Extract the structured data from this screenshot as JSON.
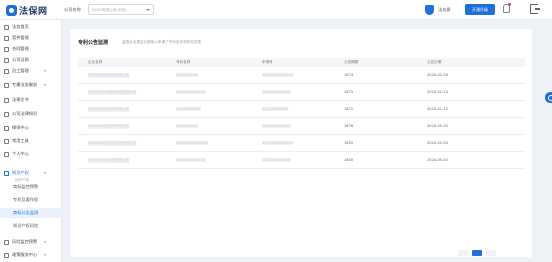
{
  "header": {
    "logo_text": "法保网",
    "company_label": "公司名称",
    "company_select_value": "XXXX有限公司(示例)",
    "shield_label": "法务盾",
    "upgrade_button": "开通升级"
  },
  "sidebar": {
    "items": [
      {
        "label": "法务首页"
      },
      {
        "label": "案件管理"
      },
      {
        "label": "合同管理"
      },
      {
        "label": "公司证照"
      },
      {
        "label": "员工管理"
      },
      {
        "label": "专属法务服务"
      },
      {
        "label": "法律文书"
      },
      {
        "label": "公司法律知识"
      },
      {
        "label": "律师中心"
      },
      {
        "label": "常用工具"
      },
      {
        "label": "个人中心"
      }
    ],
    "divider": "知识产权",
    "ip_group": {
      "label": "知识产权",
      "subs": [
        {
          "label": "商标监控预警"
        },
        {
          "label": "专利及著作权"
        },
        {
          "label": "商标公告监测"
        },
        {
          "label": "知识产权风险"
        }
      ]
    },
    "bottom_items": [
      {
        "label": "风险监控预警"
      },
      {
        "label": "政策服务中心"
      }
    ]
  },
  "main": {
    "title": "专利公告监测",
    "subtitle": "监测企业是否已被他人申请了专利及专利状态变更",
    "columns": [
      "企业名称",
      "专利名称",
      "申请号",
      "公告期数",
      "公告日期"
    ],
    "rows": [
      {
        "company": "XXXXXXXX科技有限公司",
        "patent": "XXXXXXXXX",
        "number": "2021XXXXXXXXX",
        "issue": "1874",
        "date": "2024-01-26"
      },
      {
        "company": "XXXXXXXX网络科技有限公司",
        "patent": "XXXXXXXXXXXX",
        "number": "2022XXXXXXXX",
        "issue": "1875",
        "date": "2024-02-13"
      },
      {
        "company": "XXXXXXXX科技有限公司",
        "patent": "XXXXXXXXXX",
        "number": "2021XXXXXXX",
        "issue": "1872",
        "date": "2024-01-15"
      },
      {
        "company": "XXXXXXXX技术有限公司",
        "patent": "XXXXXXXXX",
        "number": "2023XXXXXXXX",
        "issue": "1876",
        "date": "2024-05-30"
      },
      {
        "company": "XXXXXXXX电子科技有限公司",
        "patent": "XXXXXXXXXXXXX",
        "number": "2023XXXXXXXXX",
        "issue": "1855",
        "date": "2024-05-30"
      },
      {
        "company": "XXXXXXXX科技有限公司",
        "patent": "XXXXXXXXXXXX",
        "number": "2022XXXXXXXX",
        "issue": "1855",
        "date": "2024-05-30"
      }
    ]
  },
  "colors": {
    "accent": "#1f6fd8",
    "active_bg": "#e8f1fd",
    "page_bg": "#eef1f6"
  }
}
